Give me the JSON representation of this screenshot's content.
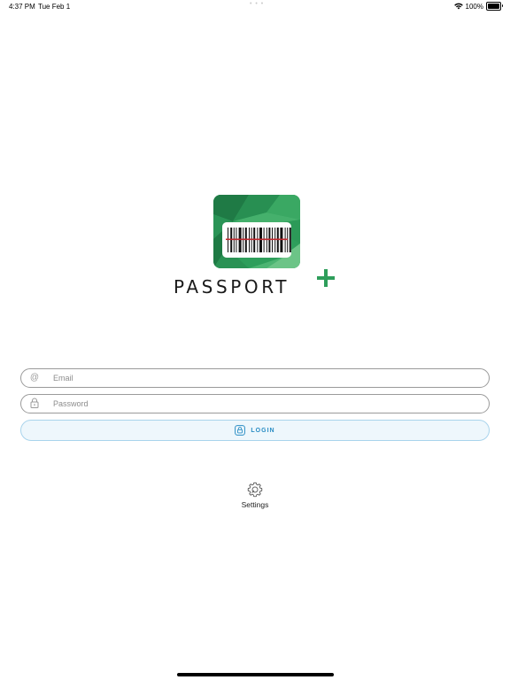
{
  "status_bar": {
    "time": "4:37 PM",
    "date": "Tue Feb 1",
    "dots": "• • •",
    "battery_percent": "100%",
    "battery_level": 1.0,
    "icons": [
      "wifi-icon",
      "battery-icon"
    ]
  },
  "brand": {
    "name": "PASSPORT",
    "plus_color": "#2e9e5b",
    "tile_colors": [
      "#1f7a45",
      "#2e9e5b",
      "#45b06c",
      "#6cc487"
    ],
    "barcode_line_color": "#c0272d"
  },
  "form": {
    "email": {
      "icon": "at-icon",
      "icon_glyph": "@",
      "placeholder": "Email",
      "value": ""
    },
    "password": {
      "icon": "lock-icon",
      "placeholder": "Password",
      "value": ""
    },
    "login": {
      "icon": "lock-box-icon",
      "label": "LOGIN",
      "accent": "#2a8dc4"
    }
  },
  "settings": {
    "icon": "gear-wrench-icon",
    "label": "Settings"
  }
}
